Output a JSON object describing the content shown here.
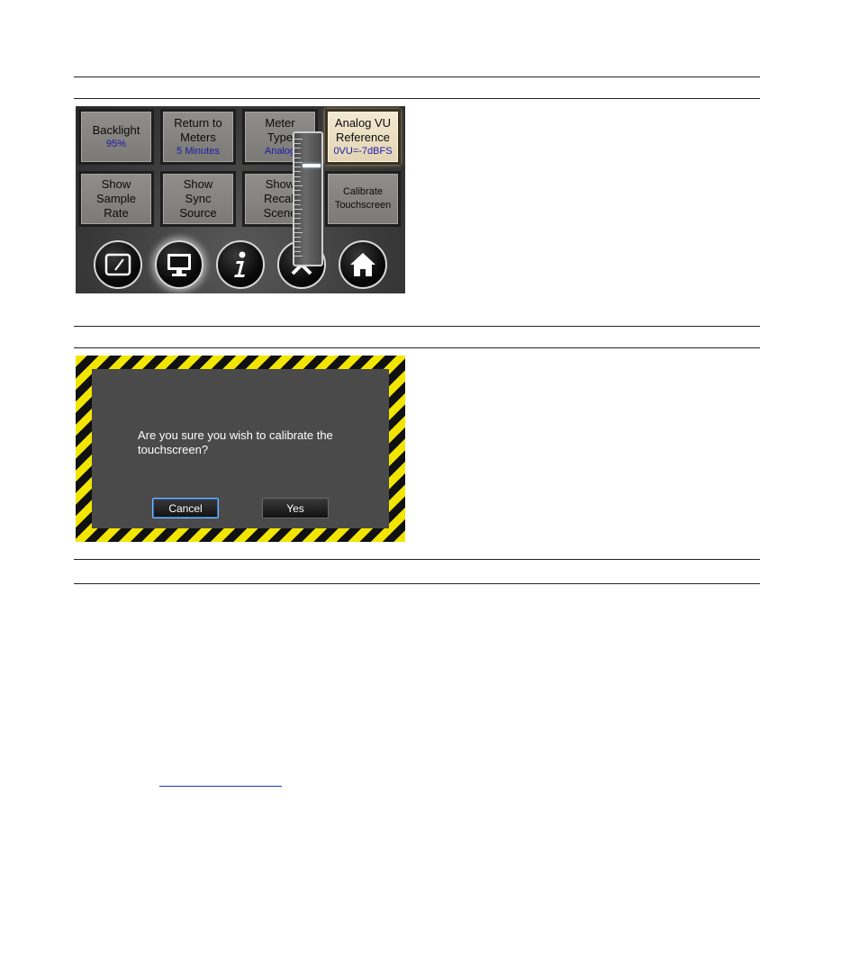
{
  "settings": {
    "buttons": [
      {
        "label": "Backlight",
        "value": "95%"
      },
      {
        "label": "Return to Meters",
        "value": "5 Minutes"
      },
      {
        "label": "Meter Type",
        "value": "Analog"
      },
      {
        "label": "Analog VU Reference",
        "value": "0VU=-7dBFS"
      },
      {
        "label": "Show Sample Rate"
      },
      {
        "label": "Show Sync Source"
      },
      {
        "label": "Show Recall Scene"
      },
      {
        "label": "Calibrate Touchscreen"
      }
    ],
    "nav_icons": [
      "meter-icon",
      "monitor-icon",
      "info-icon",
      "tools-icon",
      "home-icon"
    ],
    "value_color": "#1a1aa8",
    "active_color": "#f4ead2"
  },
  "dialog": {
    "message": "Are you sure you wish to calibrate the touchscreen?",
    "cancel_label": "Cancel",
    "yes_label": "Yes",
    "stripe_colors": [
      "#f2e600",
      "#111111"
    ]
  }
}
